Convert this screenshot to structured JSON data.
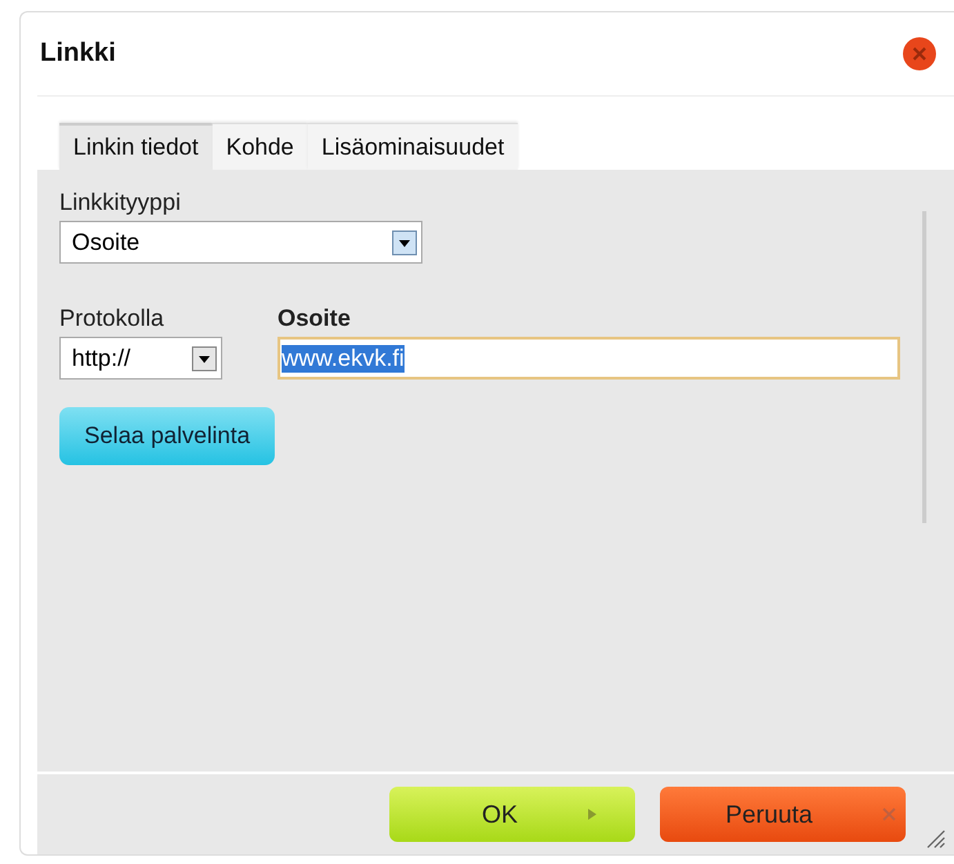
{
  "dialog": {
    "title": "Linkki"
  },
  "tabs": [
    {
      "label": "Linkin tiedot",
      "selected": true
    },
    {
      "label": "Kohde",
      "selected": false
    },
    {
      "label": "Lisäominaisuudet",
      "selected": false
    }
  ],
  "link_type": {
    "label": "Linkkityyppi",
    "value": "Osoite"
  },
  "protocol": {
    "label": "Protokolla",
    "value": "http://"
  },
  "address": {
    "label": "Osoite",
    "value": "www.ekvk.fi",
    "text_selected": true,
    "focused": true
  },
  "browse_button": "Selaa palvelinta",
  "buttons": [
    {
      "label": "OK",
      "kind": "ok"
    },
    {
      "label": "Peruuta",
      "kind": "cancel"
    }
  ]
}
